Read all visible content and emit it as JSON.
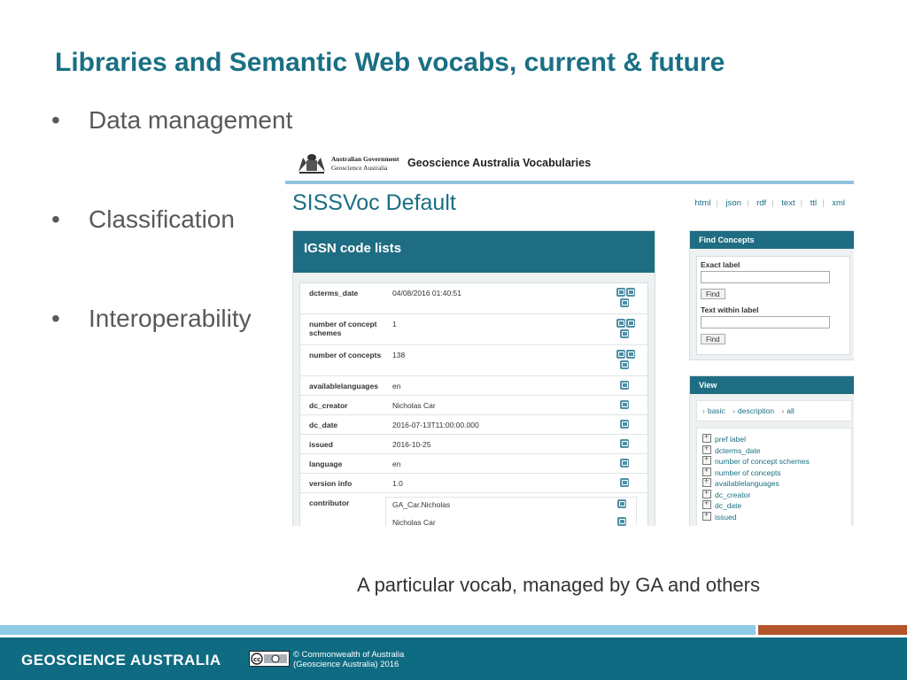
{
  "slide": {
    "title": "Libraries and Semantic Web vocabs, current & future",
    "bullets": [
      "Data management",
      "Classification",
      "Interoperability"
    ],
    "bullet_char": "•",
    "caption": "A particular vocab, managed by GA and others"
  },
  "screenshot": {
    "gov_line1": "Australian Government",
    "gov_line2": "Geoscience Australia",
    "site_title": "Geoscience Australia Vocabularies",
    "vocab_title": "SISSVoc Default",
    "formats": [
      "html",
      "json",
      "rdf",
      "text",
      "ttl",
      "xml"
    ],
    "main_panel": {
      "title": "IGSN code lists",
      "rows": [
        {
          "label": "dcterms_date",
          "value": "04/08/2016 01:40:51"
        },
        {
          "label": "number of concept schemes",
          "value": "1"
        },
        {
          "label": "number of concepts",
          "value": "138"
        },
        {
          "label": "availablelanguages",
          "value": "en"
        },
        {
          "label": "dc_creator",
          "value": "Nicholas Car"
        },
        {
          "label": "dc_date",
          "value": "2016-07-13T11:00:00.000"
        },
        {
          "label": "issued",
          "value": "2016-10-25"
        },
        {
          "label": "language",
          "value": "en"
        },
        {
          "label": "version info",
          "value": "1.0"
        },
        {
          "label": "contributor",
          "value": "GA_Car.Nicholas",
          "value2": "Nicholas Car"
        }
      ]
    },
    "find": {
      "title": "Find Concepts",
      "exact_label": "Exact label",
      "text_within_label": "Text within label",
      "find_button": "Find"
    },
    "view": {
      "title": "View",
      "crumbs": [
        "basic",
        "description",
        "all"
      ],
      "crumb_sep": "›",
      "items": [
        "pref label",
        "dcterms_date",
        "number of concept schemes",
        "number of concepts",
        "availablelanguages",
        "dc_creator",
        "dc_date",
        "issued"
      ]
    }
  },
  "footer": {
    "brand": "GEOSCIENCE AUSTRALIA",
    "copyright_line1": "© Commonwealth of Australia",
    "copyright_line2": "(Geoscience Australia) 2016"
  },
  "colors": {
    "title_teal": "#1a6f84",
    "panel_header": "#1f6d82",
    "footer_bg": "#0f6b82",
    "bar_light_blue": "#8ecbe6",
    "bar_orange": "#b3542b"
  }
}
